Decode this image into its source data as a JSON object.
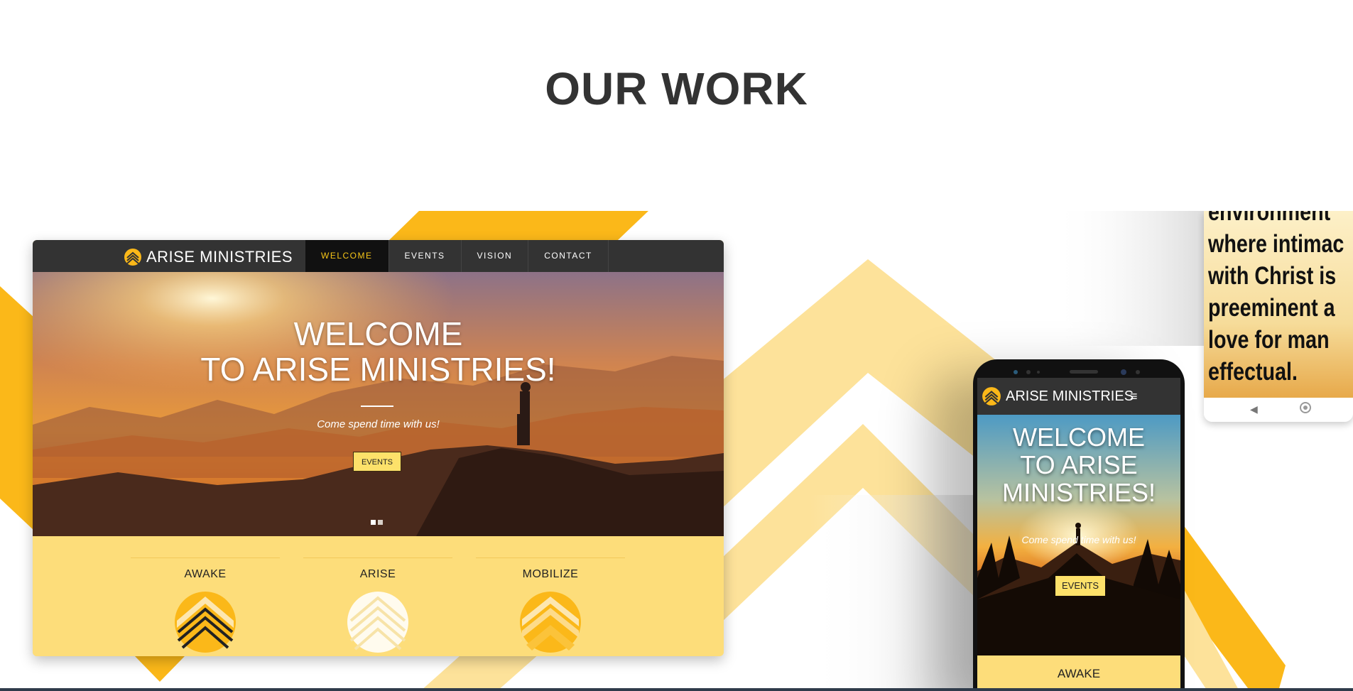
{
  "page": {
    "title": "OUR WORK"
  },
  "colors": {
    "accent_yellow": "#fbb819",
    "pale_yellow": "#fddd7a",
    "nav_dark": "#333333",
    "title_text": "#333333"
  },
  "desktop": {
    "logo_text": "ARISE MINISTRIES",
    "menu": [
      {
        "label": "WELCOME",
        "active": true
      },
      {
        "label": "EVENTS",
        "active": false
      },
      {
        "label": "VISION",
        "active": false
      },
      {
        "label": "CONTACT",
        "active": false
      }
    ],
    "hero": {
      "title_line1": "WELCOME",
      "title_line2": "TO ARISE MINISTRIES!",
      "subtitle": "Come spend time with us!",
      "button_label": "EVENTS"
    },
    "features": [
      {
        "label": "AWAKE",
        "icon": "chevrons-up-icon"
      },
      {
        "label": "ARISE",
        "icon": "chevrons-up-icon"
      },
      {
        "label": "MOBILIZE",
        "icon": "chevrons-up-icon"
      }
    ]
  },
  "phone": {
    "logo_text": "ARISE MINISTRIES",
    "menu_icon": "≡",
    "hero": {
      "title_line1": "WELCOME",
      "title_line2": "TO ARISE",
      "title_line3": "MINISTRIES!",
      "subtitle": "Come spend time with us!",
      "button_label": "EVENTS"
    },
    "feature_label": "AWAKE"
  },
  "cropped_phone": {
    "lines": [
      "environment",
      "where intimac",
      "with Christ is",
      "preeminent a",
      "love for man",
      "effectual."
    ],
    "back_icon": "◀"
  }
}
